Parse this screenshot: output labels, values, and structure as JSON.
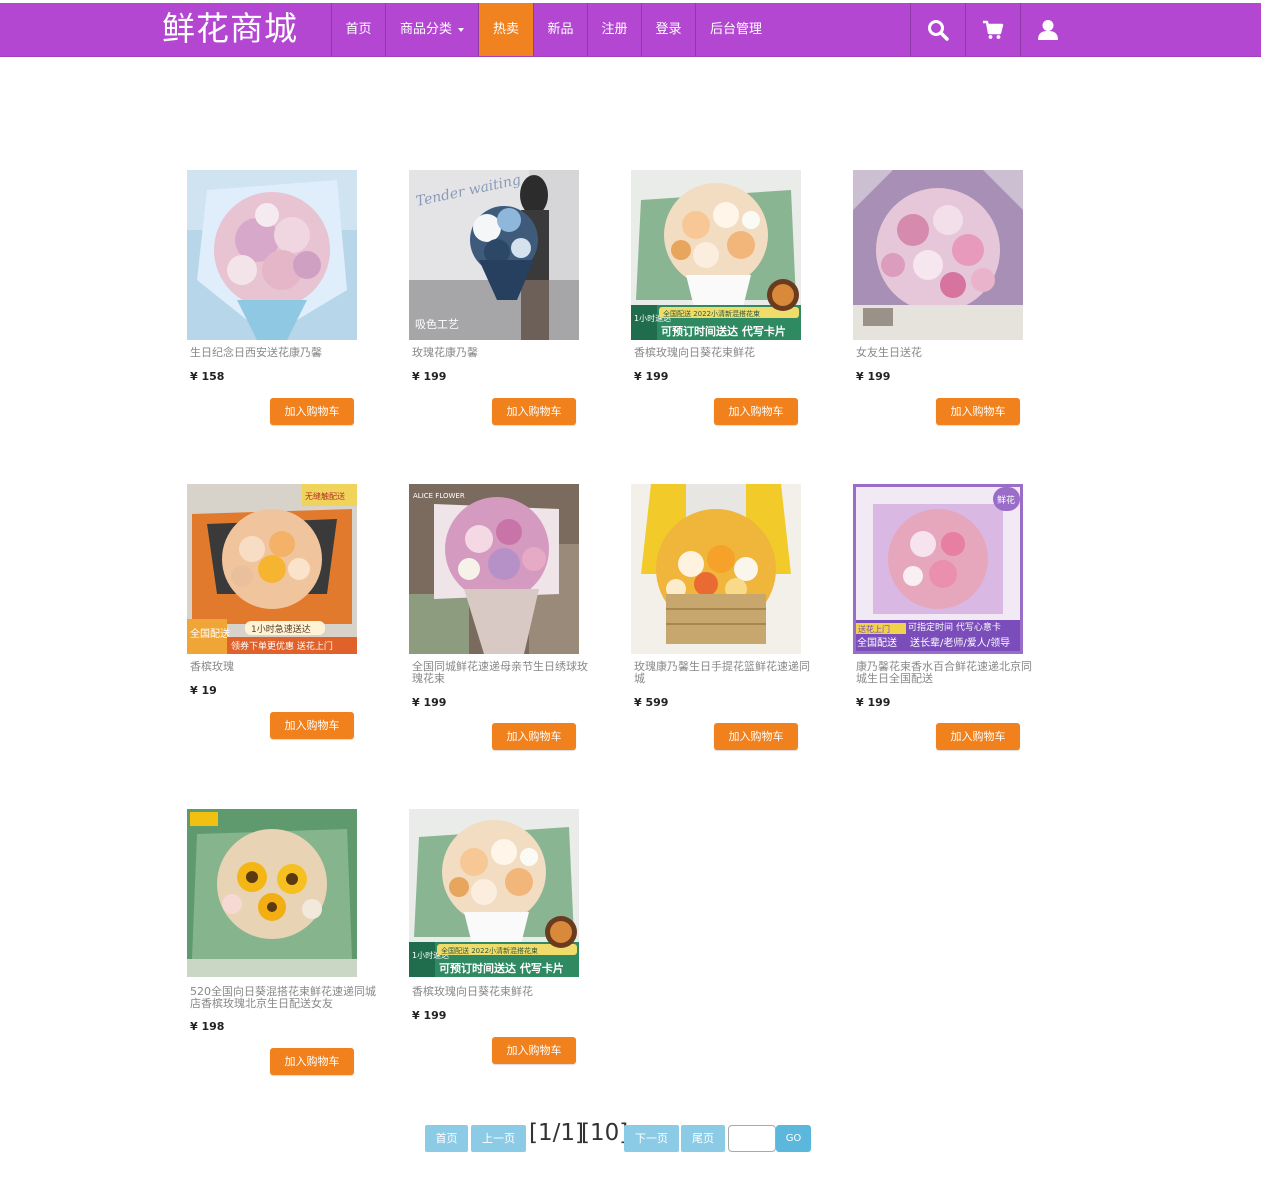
{
  "brand": "鲜花商城",
  "nav": {
    "home": "首页",
    "category": "商品分类",
    "hot": "热卖",
    "new": "新品",
    "register": "注册",
    "login": "登录",
    "admin": "后台管理"
  },
  "icons": [
    "search-icon",
    "cart-icon",
    "user-icon"
  ],
  "colors": {
    "navbar": "#b447d1",
    "active_tab": "#f0831f",
    "cart_button": "#f0811d",
    "pager_button": "#8ccbe6",
    "go_button": "#5bb8dc"
  },
  "cart_label": "加入购物车",
  "products": [
    {
      "name": "生日纪念日西安送花康乃馨",
      "price": "¥ 158"
    },
    {
      "name": "玫瑰花康乃馨",
      "price": "¥ 199"
    },
    {
      "name": "香槟玫瑰向日葵花束鲜花",
      "price": "¥ 199"
    },
    {
      "name": "女友生日送花",
      "price": "¥ 199"
    },
    {
      "name": "香槟玫瑰",
      "price": "¥ 19"
    },
    {
      "name": "全国同城鲜花速递母亲节生日绣球玫瑰花束",
      "price": "¥ 199"
    },
    {
      "name": "玫瑰康乃馨生日手提花篮鲜花速递同城",
      "price": "¥ 599"
    },
    {
      "name": "康乃馨花束香水百合鲜花速递北京同城生日全国配送",
      "price": "¥ 199"
    },
    {
      "name": "520全国向日葵混搭花束鲜花速递同城店香槟玫瑰北京生日配送女友",
      "price": "¥ 198"
    },
    {
      "name": "香槟玫瑰向日葵花束鲜花",
      "price": "¥ 199"
    }
  ],
  "image_texts": {
    "p1_script": "Tender waiting",
    "p1_caption": "吸色工艺",
    "promo_hour": "1小时速达",
    "promo_top": "全国配送 2022小清新混搭花束",
    "promo_main": "可预订时间送达 代写卡片",
    "p4_badge_top": "无缝触配送",
    "p4_national": "全国配送",
    "p4_hour": "1小时急速送达",
    "p4_coupon": "领券下单更优惠 送花上门",
    "p5_logo": "ALICE FLOWER",
    "p7_badge": "鲜花",
    "p7_line1": "可指定时间 代写心意卡",
    "p7_tag": "送花上门",
    "p7_national": "全国配送",
    "p7_line2": "送长辈/老师/爱人/领导"
  },
  "pager": {
    "first": "首页",
    "prev": "上一页",
    "page_info": "[1/1]",
    "total": "[10]",
    "next": "下一页",
    "last": "尾页",
    "input_value": "",
    "go": "GO"
  }
}
